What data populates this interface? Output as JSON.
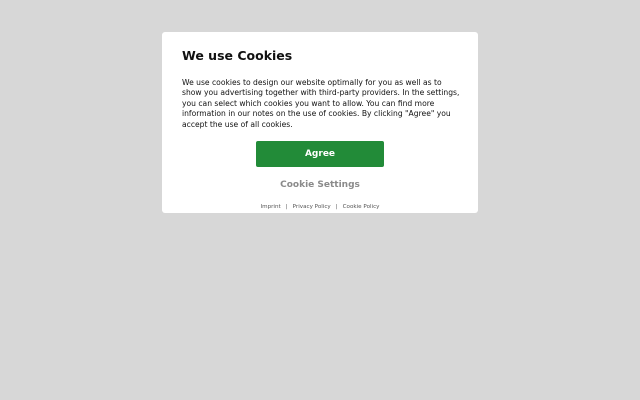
{
  "dialog": {
    "title": "We use Cookies",
    "body": "We use cookies to design our website optimally for you as well as to show you advertising together with third-party providers. In the settings, you can select which cookies you want to allow. You can find more information in our notes on the use of cookies. By clicking \"Agree\" you accept the use of all cookies.",
    "agree_label": "Agree",
    "settings_label": "Cookie Settings"
  },
  "footer": {
    "links": [
      "Imprint",
      "Privacy Policy",
      "Cookie Policy"
    ],
    "separator": "|"
  },
  "colors": {
    "background": "#d7d7d7",
    "dialog": "#ffffff",
    "accent": "#228b38",
    "muted": "#8a8a8a"
  }
}
